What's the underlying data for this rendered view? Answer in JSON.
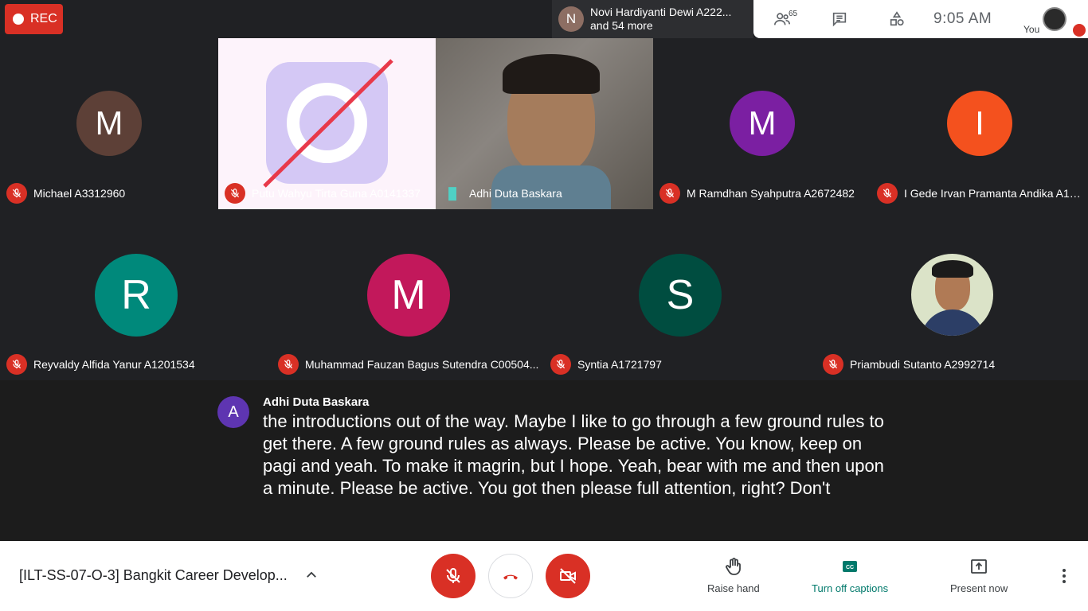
{
  "header": {
    "rec_label": "REC",
    "speaker_initial": "N",
    "speaker_name": "Novi Hardiyanti Dewi A222...",
    "speaker_more": "and 54 more",
    "participant_count": "65",
    "time": "9:05  AM",
    "you_label": "You"
  },
  "tiles": [
    {
      "initial": "M",
      "name": "Michael A3312960"
    },
    {
      "name": "Putu Wahyu Tirta Guna A0141337"
    },
    {
      "name": "Adhi Duta Baskara"
    },
    {
      "initial": "M",
      "name": "M Ramdhan Syahputra A2672482"
    },
    {
      "initial": "I",
      "name": "I Gede Irvan Pramanta Andika A17..."
    },
    {
      "initial": "R",
      "name": "Reyvaldy Alfida Yanur A1201534"
    },
    {
      "initial": "M",
      "name": "Muhammad Fauzan Bagus Sutendra C00504..."
    },
    {
      "initial": "S",
      "name": "Syntia A1721797"
    },
    {
      "name": "Priambudi Sutanto A2992714"
    }
  ],
  "captions": {
    "initial": "A",
    "speaker": "Adhi Duta Baskara",
    "text": "the introductions out of the way. Maybe I like to go through a few ground rules to get there. A few ground rules as always. Please be active. You know, keep on pagi and yeah. To make it magrin, but I hope. Yeah, bear with me and then upon a minute. Please be active. You got then please full attention, right? Don't"
  },
  "footer": {
    "meeting_title": "[ILT-SS-07-O-3] Bangkit Career Develop...",
    "raise_hand": "Raise hand",
    "captions_toggle": "Turn off captions",
    "present_now": "Present now"
  },
  "colors": {
    "red": "#d93025",
    "teal_accent": "#00796b",
    "avatar_brown": "#5d4037",
    "avatar_purple": "#7b1fa2",
    "avatar_orange": "#f4511e",
    "avatar_teal": "#00897b",
    "avatar_pink": "#c2185b",
    "avatar_darkgreen": "#004d40"
  }
}
